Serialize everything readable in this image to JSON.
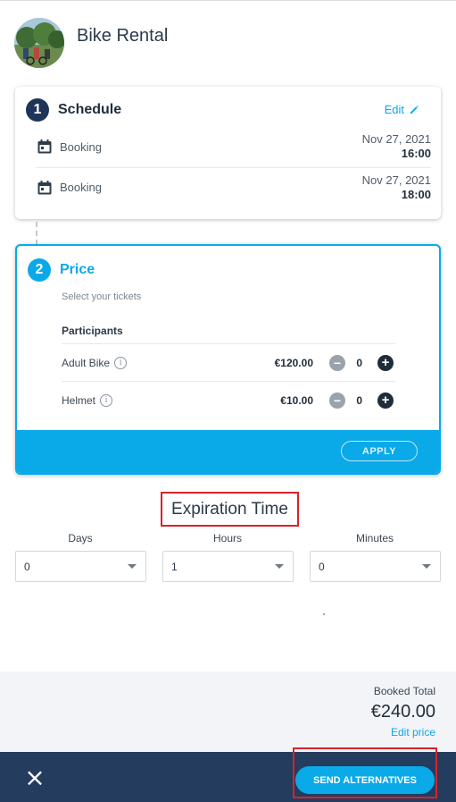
{
  "header": {
    "title": "Bike Rental"
  },
  "schedule": {
    "step": "1",
    "title": "Schedule",
    "edit_label": "Edit",
    "rows": [
      {
        "label": "Booking",
        "date": "Nov 27, 2021",
        "time": "16:00"
      },
      {
        "label": "Booking",
        "date": "Nov 27, 2021",
        "time": "18:00"
      }
    ]
  },
  "price": {
    "step": "2",
    "title": "Price",
    "subtitle": "Select your tickets",
    "participants_label": "Participants",
    "items": [
      {
        "label": "Adult Bike",
        "price": "€120.00",
        "qty": "0"
      },
      {
        "label": "Helmet",
        "price": "€10.00",
        "qty": "0"
      }
    ],
    "apply_label": "APPLY"
  },
  "expiration": {
    "title": "Expiration Time",
    "days": {
      "label": "Days",
      "value": "0"
    },
    "hours": {
      "label": "Hours",
      "value": "1"
    },
    "minutes": {
      "label": "Minutes",
      "value": "0"
    }
  },
  "total": {
    "label": "Booked Total",
    "amount": "€240.00",
    "edit_price": "Edit price"
  },
  "footer": {
    "close_icon": "×",
    "send_label": "SEND ALTERNATIVES"
  },
  "colors": {
    "accent": "#0aa9e8",
    "navy": "#243c5e",
    "highlight": "#d8232a"
  }
}
